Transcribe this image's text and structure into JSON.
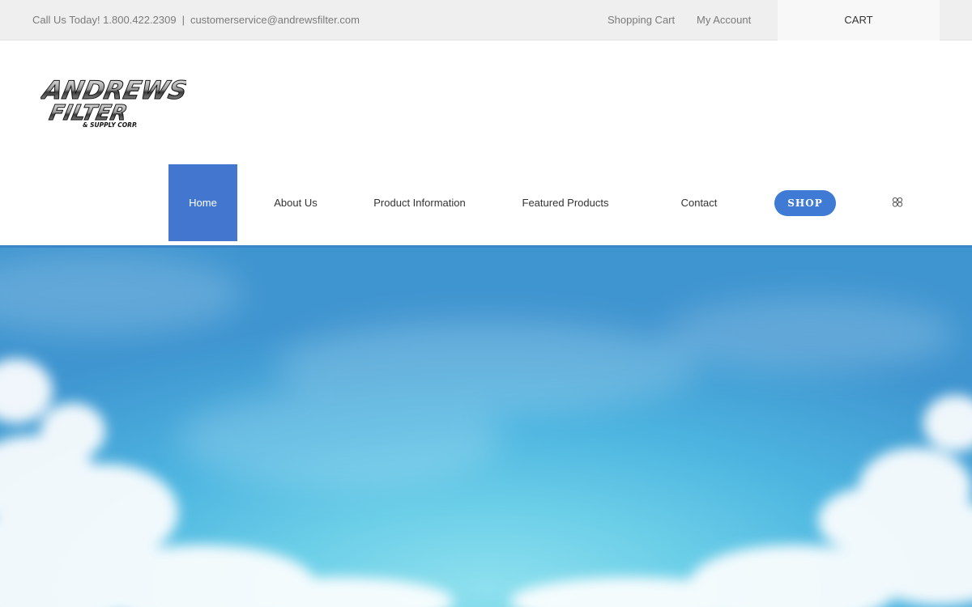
{
  "topbar": {
    "phone_text": "Call Us Today! 1.800.422.2309",
    "separator": "|",
    "email": "customerservice@andrewsfilter.com",
    "shopping_cart": "Shopping Cart",
    "my_account": "My Account",
    "cart": "CART"
  },
  "logo": {
    "line1": "ANDREWS",
    "line2": "FILTER",
    "line3": "& SUPPLY CORP."
  },
  "nav": {
    "items": [
      {
        "label": "Home",
        "active": true
      },
      {
        "label": "About Us"
      },
      {
        "label": "Product Information"
      },
      {
        "label": "Featured Products"
      },
      {
        "label": "Contact"
      }
    ],
    "shop_label": "SHOP",
    "search_icon": "search-icon"
  },
  "colors": {
    "accent": "#4377cf",
    "shop_button": "#3f7bd4",
    "topbar_bg": "#efefef"
  }
}
